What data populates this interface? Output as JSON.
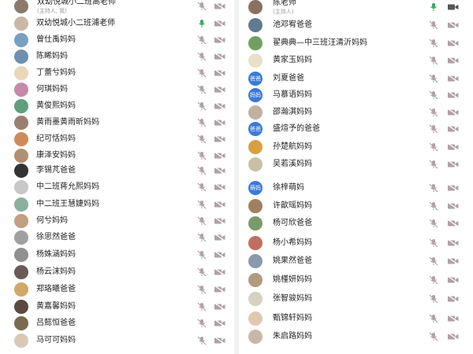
{
  "left": {
    "rows": [
      {
        "name": "双幼悦城小二班高老师",
        "role": "(主持人, 我)",
        "avatar": "#8a7a6a",
        "mic": "muted",
        "cam": "off"
      },
      {
        "name": "双幼悦城小二班浦老师",
        "avatar": "#c9b8a6",
        "mic": "on",
        "cam": "off"
      },
      {
        "name": "曾仕禹妈妈",
        "avatar": "#7aa0c0",
        "mic": "muted",
        "cam": "off"
      },
      {
        "name": "陈睎妈妈",
        "avatar": "#6f8fb0",
        "mic": "muted",
        "cam": "off"
      },
      {
        "name": "丁蕾兮妈妈",
        "avatar": "#e8d8b8",
        "mic": "muted",
        "cam": "off"
      },
      {
        "name": "何琪妈妈",
        "avatar": "#c48aa8",
        "mic": "muted",
        "cam": "off"
      },
      {
        "name": "黄俊熙妈妈",
        "avatar": "#5f9f7a",
        "mic": "muted",
        "cam": "off"
      },
      {
        "name": "黄雨墨黄雨昕妈妈",
        "avatar": "#9a8070",
        "mic": "muted",
        "cam": "off"
      },
      {
        "name": "纪可恬妈妈",
        "avatar": "#d08a5a",
        "mic": "muted",
        "cam": "off"
      },
      {
        "name": "康泽安妈妈",
        "avatar": "#b09070",
        "mic": "muted",
        "cam": "off"
      },
      {
        "name": "李锡芃爸爸",
        "avatar": "#333333",
        "mic": "muted",
        "cam": "off"
      },
      {
        "name": "中二班蒋允熙妈妈",
        "avatar": "#c8c8c8",
        "mic": "muted",
        "cam": "off"
      },
      {
        "name": "中二班王慧婕妈妈",
        "avatar": "#8ab0a0",
        "mic": "muted",
        "cam": "off"
      },
      {
        "name": "何兮妈妈",
        "avatar": "#c0a080",
        "mic": "muted",
        "cam": "off"
      },
      {
        "name": "徐思然爸爸",
        "avatar": "#a0a0a0",
        "mic": "muted",
        "cam": "off"
      },
      {
        "name": "杨姝涵妈妈",
        "avatar": "#909090",
        "mic": "muted",
        "cam": "off"
      },
      {
        "name": "杨云沫妈妈",
        "avatar": "#6a5a5a",
        "mic": "muted",
        "cam": "off"
      },
      {
        "name": "郑珞曦爸爸",
        "avatar": "#d0a868",
        "mic": "muted",
        "cam": "off"
      },
      {
        "name": "黄嘉馨妈妈",
        "avatar": "#5a4a40",
        "mic": "muted",
        "cam": "off"
      },
      {
        "name": "吕懿恒爸爸",
        "avatar": "#7a6a50",
        "mic": "muted",
        "cam": "off"
      },
      {
        "name": "马可可妈妈",
        "avatar": "#d8c8b8",
        "mic": "muted",
        "cam": "off"
      }
    ]
  },
  "right": {
    "rows": [
      {
        "name": "陈老师",
        "role": "(主持人)",
        "avatar": "#8a7060",
        "mic": "on",
        "cam": "on"
      },
      {
        "name": "池邓宥爸爸",
        "avatar": "#607a90",
        "mic": "muted",
        "cam": "off"
      },
      {
        "name": "翟典典—中三班汪清沂妈妈",
        "avatar": "#70a060",
        "mic": "muted",
        "cam": "off"
      },
      {
        "name": "黄家玉妈妈",
        "avatar": "#e8e0c8",
        "mic": "muted",
        "cam": "off"
      },
      {
        "name": "刘夏爸爸",
        "avatar": "#3a7ad8",
        "avatar_text": "爸爸",
        "mic": "muted",
        "cam": "off"
      },
      {
        "name": "马慕语妈妈",
        "avatar": "#3a7ad8",
        "avatar_text": "妈妈",
        "mic": "muted",
        "cam": "off"
      },
      {
        "name": "邵瀚淇妈妈",
        "avatar": "#c0b0a0",
        "mic": "muted",
        "cam": "off"
      },
      {
        "name": "盛煊予的爸爸",
        "avatar": "#3a7ad8",
        "avatar_text": "爸爸",
        "mic": "muted",
        "cam": "off"
      },
      {
        "name": "孙楚航妈妈",
        "avatar": "#d8a040",
        "mic": "muted",
        "cam": "off"
      },
      {
        "name": "吴若溪妈妈",
        "avatar": "#c8c0a8",
        "mic": "muted",
        "cam": "off"
      },
      {
        "name": "徐梓萌妈",
        "avatar": "#3a7ad8",
        "avatar_text": "萌妈",
        "mic": "muted",
        "cam": "off"
      },
      {
        "name": "许歆瑶妈妈",
        "avatar": "#a08060",
        "mic": "muted",
        "cam": "off"
      },
      {
        "name": "杨可欣爸爸",
        "avatar": "#7a9a6a",
        "mic": "muted",
        "cam": "off"
      },
      {
        "name": "杨小希妈妈",
        "avatar": "#c07060",
        "mic": "muted",
        "cam": "off"
      },
      {
        "name": "姚果然爸爸",
        "avatar": "#8a9aaa",
        "mic": "muted",
        "cam": "off"
      },
      {
        "name": "姚槿妍妈妈",
        "avatar": "#b09a80",
        "mic": "muted",
        "cam": "off"
      },
      {
        "name": "张智骏妈妈",
        "avatar": "#d8d0c0",
        "mic": "muted",
        "cam": "off"
      },
      {
        "name": "甄锦轩妈妈",
        "avatar": "#e0c8b0",
        "mic": "muted",
        "cam": "off"
      },
      {
        "name": "朱启路妈妈",
        "avatar": "#c8b8a8",
        "mic": "muted",
        "cam": "off"
      }
    ]
  },
  "colors": {
    "muted_icon": "#b0a0a8",
    "on_mic": "#2fae5a",
    "cam_off": "#b0a0a8",
    "cam_on": "#555555",
    "avatar_blue": "#3a7ad8"
  },
  "icons": {
    "mic_muted": "mic-muted-icon",
    "mic_on": "mic-on-icon",
    "cam_off": "camera-off-icon",
    "cam_on": "camera-on-icon"
  }
}
